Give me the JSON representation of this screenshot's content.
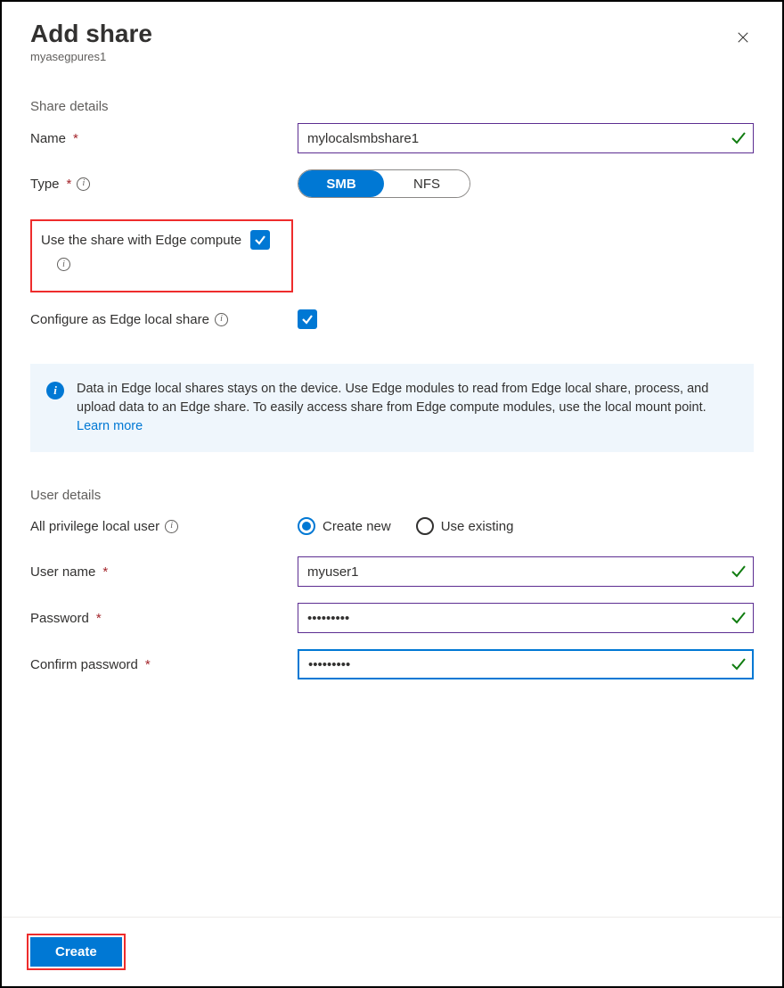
{
  "header": {
    "title": "Add share",
    "subtitle": "myasegpures1"
  },
  "share_details": {
    "section": "Share details",
    "name_label": "Name",
    "name_value": "mylocalsmbshare1",
    "type_label": "Type",
    "type_options": {
      "smb": "SMB",
      "nfs": "NFS"
    },
    "type_selected": "SMB",
    "edge_compute_label": "Use the share with Edge compute",
    "edge_compute_checked": true,
    "local_share_label": "Configure as Edge local share",
    "local_share_checked": true
  },
  "info_banner": {
    "text": "Data in Edge local shares stays on the device. Use Edge modules to read from Edge local share, process, and upload data to an Edge share. To easily access share from Edge compute modules, use the local mount point. ",
    "link": "Learn more"
  },
  "user_details": {
    "section": "User details",
    "privilege_label": "All privilege local user",
    "radio_create": "Create new",
    "radio_existing": "Use existing",
    "radio_selected": "create",
    "username_label": "User name",
    "username_value": "myuser1",
    "password_label": "Password",
    "password_value": "•••••••••",
    "confirm_label": "Confirm password",
    "confirm_value": "•••••••••"
  },
  "footer": {
    "create": "Create"
  }
}
